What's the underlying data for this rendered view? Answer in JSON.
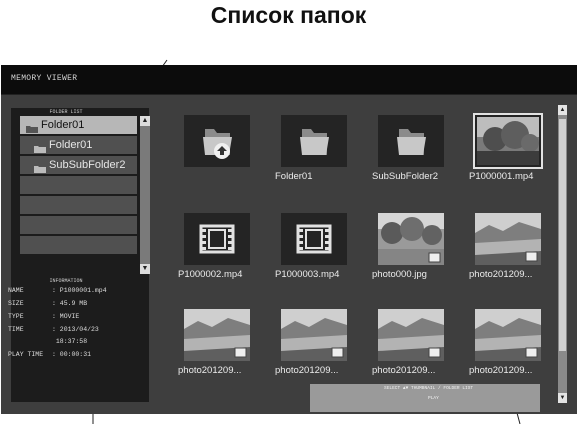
{
  "callout": {
    "title": "Список папок"
  },
  "window": {
    "title": "MEMORY VIEWER"
  },
  "folder_list": {
    "heading": "FOLDER LIST",
    "items": [
      {
        "label": "Folder01",
        "selected": true
      },
      {
        "label": "Folder01",
        "selected": false
      },
      {
        "label": "SubSubFolder2",
        "selected": false
      },
      {
        "label": "",
        "selected": false
      },
      {
        "label": "",
        "selected": false
      },
      {
        "label": "",
        "selected": false
      },
      {
        "label": "",
        "selected": false
      }
    ]
  },
  "information": {
    "heading": "INFORMATION",
    "rows": [
      {
        "key": "NAME",
        "value": ": P1000001.mp4"
      },
      {
        "key": "SIZE",
        "value": ": 45.9 MB"
      },
      {
        "key": "TYPE",
        "value": ": MOVIE"
      },
      {
        "key": "TIME",
        "value": ": 2013/04/23"
      },
      {
        "key": "",
        "value": "  18:37:58"
      },
      {
        "key": "PLAY TIME",
        "value": ": 00:00:31"
      }
    ]
  },
  "thumbnails": [
    {
      "label": "",
      "kind": "up-folder",
      "selected": false
    },
    {
      "label": "Folder01",
      "kind": "folder",
      "selected": false
    },
    {
      "label": "SubSubFolder2",
      "kind": "folder",
      "selected": false
    },
    {
      "label": "P1000001.mp4",
      "kind": "video-preview",
      "selected": true
    },
    {
      "label": "P1000002.mp4",
      "kind": "movie",
      "selected": false
    },
    {
      "label": "P1000003.mp4",
      "kind": "movie",
      "selected": false
    },
    {
      "label": "photo000.jpg",
      "kind": "photo-trees",
      "selected": false
    },
    {
      "label": "photo201209...",
      "kind": "photo-lake",
      "selected": false
    },
    {
      "label": "photo201209...",
      "kind": "photo-lake",
      "selected": false
    },
    {
      "label": "photo201209...",
      "kind": "photo-lake",
      "selected": false
    },
    {
      "label": "photo201209...",
      "kind": "photo-lake",
      "selected": false
    },
    {
      "label": "photo201209...",
      "kind": "photo-lake",
      "selected": false
    }
  ],
  "help": {
    "line1": "SELECT ▲▼ THUMBNAIL / FOLDER LIST",
    "line2": "PLAY"
  },
  "colors": {
    "background": "#121212",
    "panel": "#3e3e3e",
    "accent": "#dcdcdc"
  }
}
